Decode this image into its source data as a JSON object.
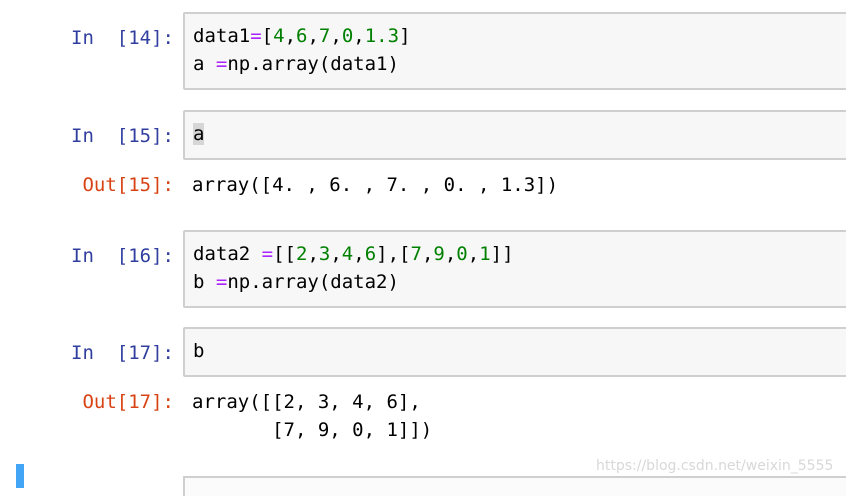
{
  "cells": [
    {
      "prompt": "In  [14]:",
      "lines": [
        [
          [
            "t",
            "data1"
          ],
          [
            "o",
            "="
          ],
          [
            "t",
            "["
          ],
          [
            "n",
            "4"
          ],
          [
            "t",
            ","
          ],
          [
            "n",
            "6"
          ],
          [
            "t",
            ","
          ],
          [
            "n",
            "7"
          ],
          [
            "t",
            ","
          ],
          [
            "n",
            "0"
          ],
          [
            "t",
            ","
          ],
          [
            "n",
            "1.3"
          ],
          [
            "t",
            "]"
          ]
        ],
        [
          [
            "t",
            "a "
          ],
          [
            "o",
            "="
          ],
          [
            "t",
            "np.array(data1)"
          ]
        ]
      ]
    },
    {
      "prompt": "In  [15]:",
      "lines": [
        [
          [
            "c",
            "a"
          ]
        ]
      ]
    },
    {
      "prompt": "In  [16]:",
      "lines": [
        [
          [
            "t",
            "data2 "
          ],
          [
            "o",
            "="
          ],
          [
            "t",
            "[["
          ],
          [
            "n",
            "2"
          ],
          [
            "t",
            ","
          ],
          [
            "n",
            "3"
          ],
          [
            "t",
            ","
          ],
          [
            "n",
            "4"
          ],
          [
            "t",
            ","
          ],
          [
            "n",
            "6"
          ],
          [
            "t",
            "],["
          ],
          [
            "n",
            "7"
          ],
          [
            "t",
            ","
          ],
          [
            "n",
            "9"
          ],
          [
            "t",
            ","
          ],
          [
            "n",
            "0"
          ],
          [
            "t",
            ","
          ],
          [
            "n",
            "1"
          ],
          [
            "t",
            "]]"
          ]
        ],
        [
          [
            "t",
            "b "
          ],
          [
            "o",
            "="
          ],
          [
            "t",
            "np.array(data2)"
          ]
        ]
      ]
    },
    {
      "prompt": "In  [17]:",
      "lines": [
        [
          [
            "t",
            "b"
          ]
        ]
      ]
    }
  ],
  "outputs": [
    {
      "prompt": "Out[15]:",
      "text": "array([4. , 6. , 7. , 0. , 1.3])"
    },
    {
      "prompt": "Out[17]:",
      "text": "array([[2, 3, 4, 6],\n       [7, 9, 0, 1]])"
    }
  ],
  "watermark": "https://blog.csdn.net/weixin_5555",
  "colors": {
    "in_prompt": "#303f9f",
    "out_prompt": "#d84315",
    "operator": "#aa22ff",
    "number": "#008000",
    "selected_bar": "#42a5f5"
  }
}
